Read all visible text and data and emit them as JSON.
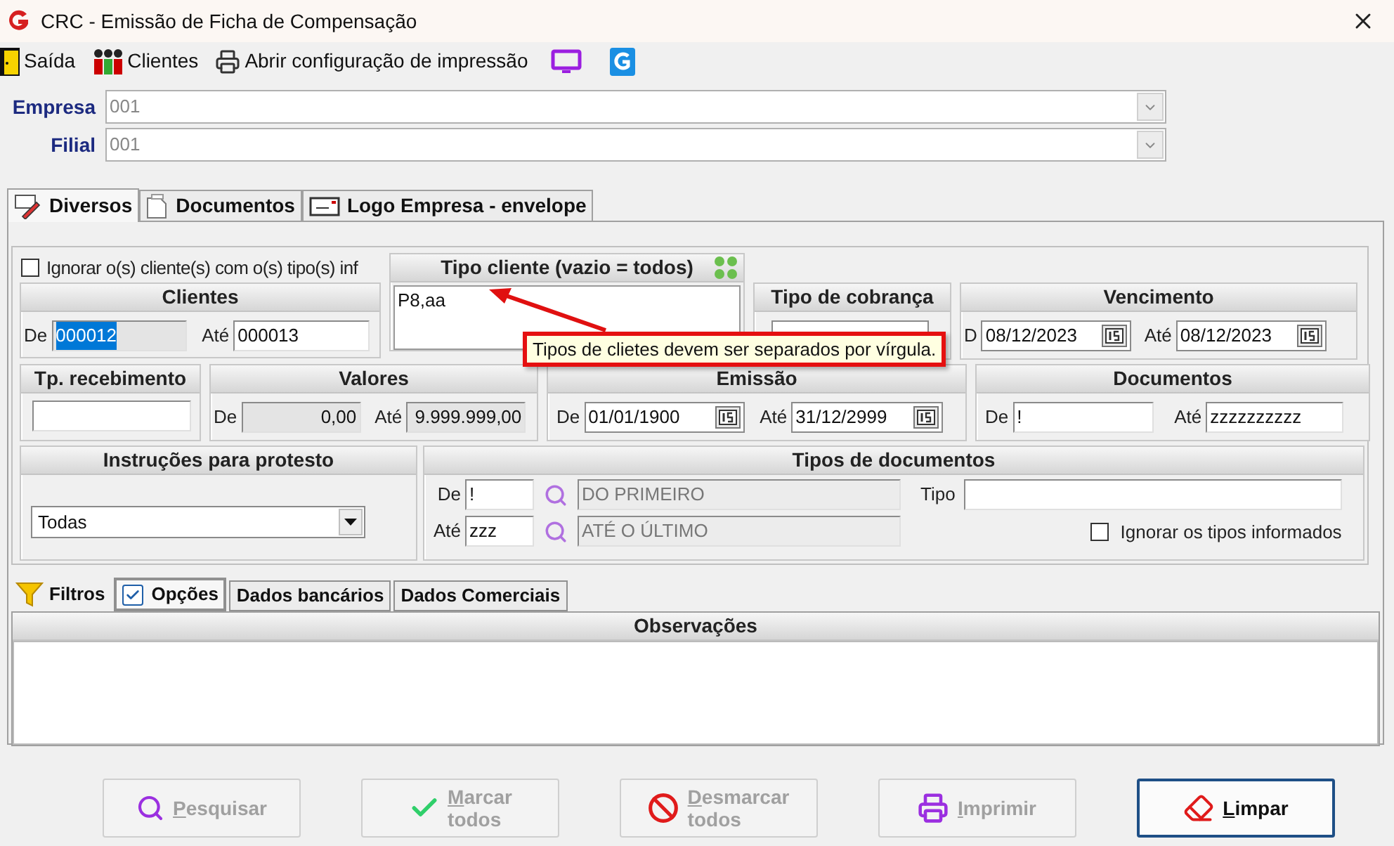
{
  "window": {
    "title": "CRC - Emissão de Ficha de Compensação"
  },
  "toolbar": [
    {
      "kind": "exit",
      "label": "Saída"
    },
    {
      "kind": "clients",
      "label": "Clientes"
    },
    {
      "kind": "print",
      "label": "Abrir configuração de impressão"
    },
    {
      "kind": "monitor"
    },
    {
      "kind": "logo"
    }
  ],
  "company_fields": [
    {
      "label": "Empresa",
      "code": "001"
    },
    {
      "label": "Filial",
      "code": "001"
    }
  ],
  "tabs": [
    {
      "kind": "pencil",
      "label": "Diversos",
      "selected": true
    },
    {
      "kind": "document",
      "label": "Documentos",
      "selected": false
    },
    {
      "kind": "envelope",
      "label": "Logo Empresa - envelope",
      "selected": false
    }
  ],
  "ignore_client_types": {
    "label": "Ignorar o(s) cliente(s) com o(s) tipo(s) inf",
    "checked": false
  },
  "clientes": {
    "title": "Clientes",
    "from_label": "De",
    "from": "000012",
    "from_highlighted": true,
    "to_label": "Até",
    "to": "000013"
  },
  "tipo_cliente": {
    "title": "Tipo cliente (vazio = todos)",
    "value": "P8,aa"
  },
  "tipo_cobranca": {
    "title": "Tipo de cobrança"
  },
  "vencimento": {
    "title": "Vencimento",
    "from_label": "D",
    "from": "08/12/2023",
    "to_label": "Até",
    "to": "08/12/2023"
  },
  "tp_recebimento": {
    "title": "Tp. recebimento"
  },
  "valores": {
    "title": "Valores",
    "from_label": "De",
    "from": "0,00",
    "to_label": "Até",
    "to": "9.999.999,00"
  },
  "emissao": {
    "title": "Emissão",
    "from_label": "De",
    "from": "01/01/1900",
    "to_label": "Até",
    "to": "31/12/2999"
  },
  "documentos": {
    "title": "Documentos",
    "from_label": "De",
    "from": "!",
    "to_label": "Até",
    "to": "zzzzzzzzzz"
  },
  "instrucoes": {
    "title": "Instruções para protesto",
    "value": "Todas"
  },
  "tipos_documentos": {
    "title": "Tipos de documentos",
    "from_label": "De",
    "from": "!",
    "from_desc": "DO PRIMEIRO",
    "to_label": "Até",
    "to": "zzz",
    "to_desc": "ATÉ O ÚLTIMO",
    "type_label": "Tipo",
    "ignore_label": "Ignorar os tipos informados",
    "ignore_checked": false
  },
  "filters_label": "Filtros",
  "subtabs": [
    {
      "label": "Opções",
      "selected": true,
      "checked": true
    },
    {
      "label": "Dados bancários",
      "selected": false
    },
    {
      "label": "Dados Comerciais",
      "selected": false
    }
  ],
  "observacoes": {
    "title": "Observações"
  },
  "tooltip": "Tipos de clietes devem ser separados por vírgula.",
  "buttons": [
    {
      "kind": "search",
      "label": "Pesquisar",
      "disabled": true
    },
    {
      "kind": "check",
      "label": "Marcar todos",
      "disabled": true
    },
    {
      "kind": "block",
      "label": "Desmarcar todos",
      "disabled": true
    },
    {
      "kind": "print",
      "label": "Imprimir",
      "disabled": true
    },
    {
      "kind": "eraser",
      "label": "Limpar",
      "disabled": false
    }
  ]
}
